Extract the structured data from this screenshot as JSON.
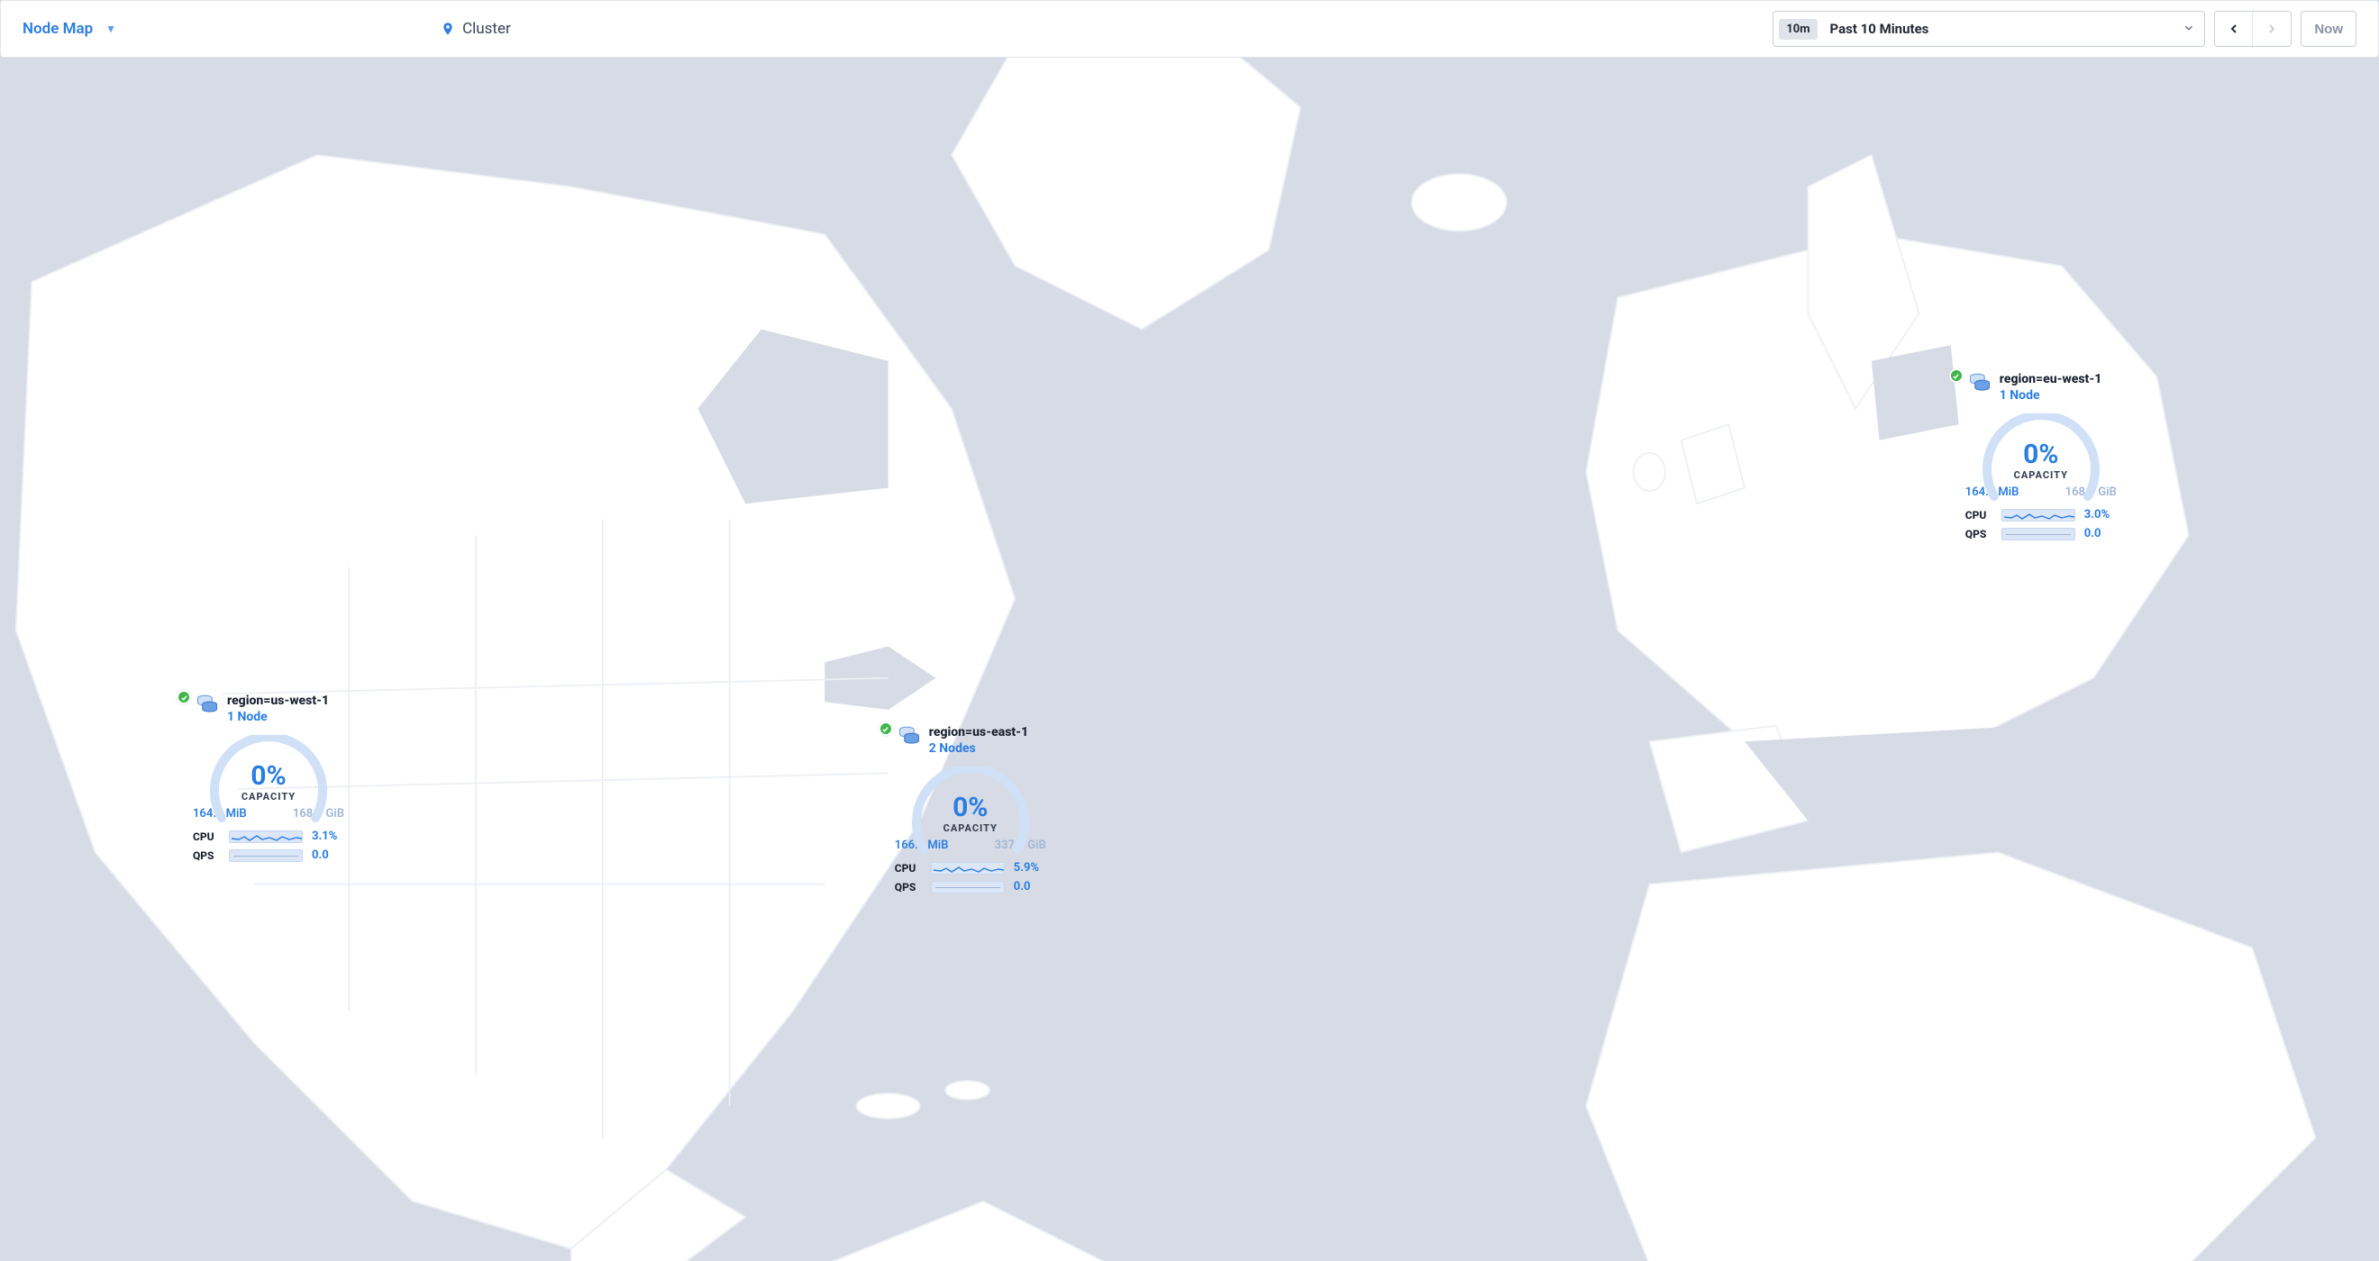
{
  "header": {
    "view_label": "Node Map",
    "breadcrumb_label": "Cluster",
    "time_badge": "10m",
    "time_label": "Past 10 Minutes",
    "now_label": "Now"
  },
  "regions": [
    {
      "id": "us-west-1",
      "name": "region=us-west-1",
      "node_count_label": "1 Node",
      "capacity_percent": "0%",
      "capacity_label": "CAPACITY",
      "used": "164.3 MiB",
      "total": "168.9 GiB",
      "cpu_label": "CPU",
      "cpu_value": "3.1%",
      "qps_label": "QPS",
      "qps_value": "0.0",
      "pos": {
        "left_pct": 7.5,
        "top_pct": 55.0
      }
    },
    {
      "id": "us-east-1",
      "name": "region=us-east-1",
      "node_count_label": "2 Nodes",
      "capacity_percent": "0%",
      "capacity_label": "CAPACITY",
      "used": "166.3 MiB",
      "total": "337.9 GiB",
      "cpu_label": "CPU",
      "cpu_value": "5.9%",
      "qps_label": "QPS",
      "qps_value": "0.0",
      "pos": {
        "left_pct": 37.0,
        "top_pct": 57.5
      }
    },
    {
      "id": "eu-west-1",
      "name": "region=eu-west-1",
      "node_count_label": "1 Node",
      "capacity_percent": "0%",
      "capacity_label": "CAPACITY",
      "used": "164.4 MiB",
      "total": "168.9 GiB",
      "cpu_label": "CPU",
      "cpu_value": "3.0%",
      "qps_label": "QPS",
      "qps_value": "0.0",
      "pos": {
        "left_pct": 82.0,
        "top_pct": 29.5
      }
    }
  ]
}
